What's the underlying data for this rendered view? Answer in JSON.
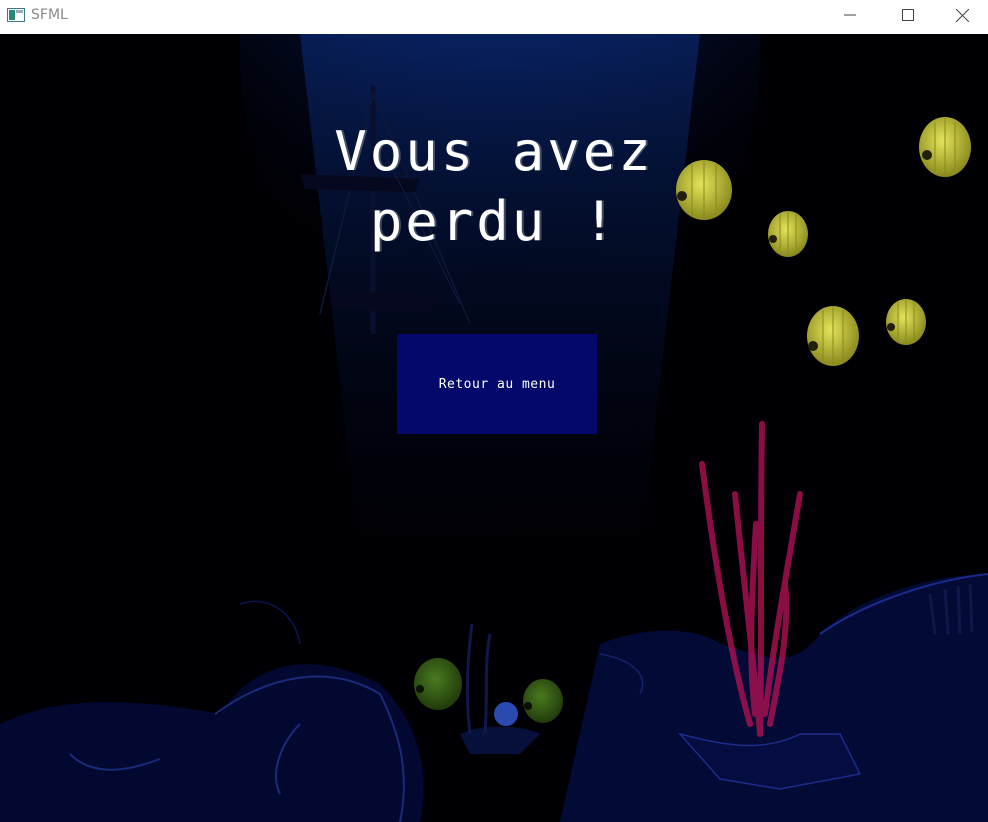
{
  "window": {
    "title": "SFML"
  },
  "game": {
    "title_line1": "Vous avez",
    "title_line2": "perdu !",
    "menu_button_label": "Retour au menu"
  },
  "colors": {
    "background": "#000005",
    "button": "#03086a",
    "text": "#ffffff",
    "light_ray": "#0a3a8a",
    "fish": "#c8c83a",
    "coral": "#b01060",
    "rock": "#0a1450"
  },
  "icons": {
    "app": "sfml-window-icon",
    "minimize": "minimize-icon",
    "maximize": "maximize-icon",
    "close": "close-icon"
  }
}
